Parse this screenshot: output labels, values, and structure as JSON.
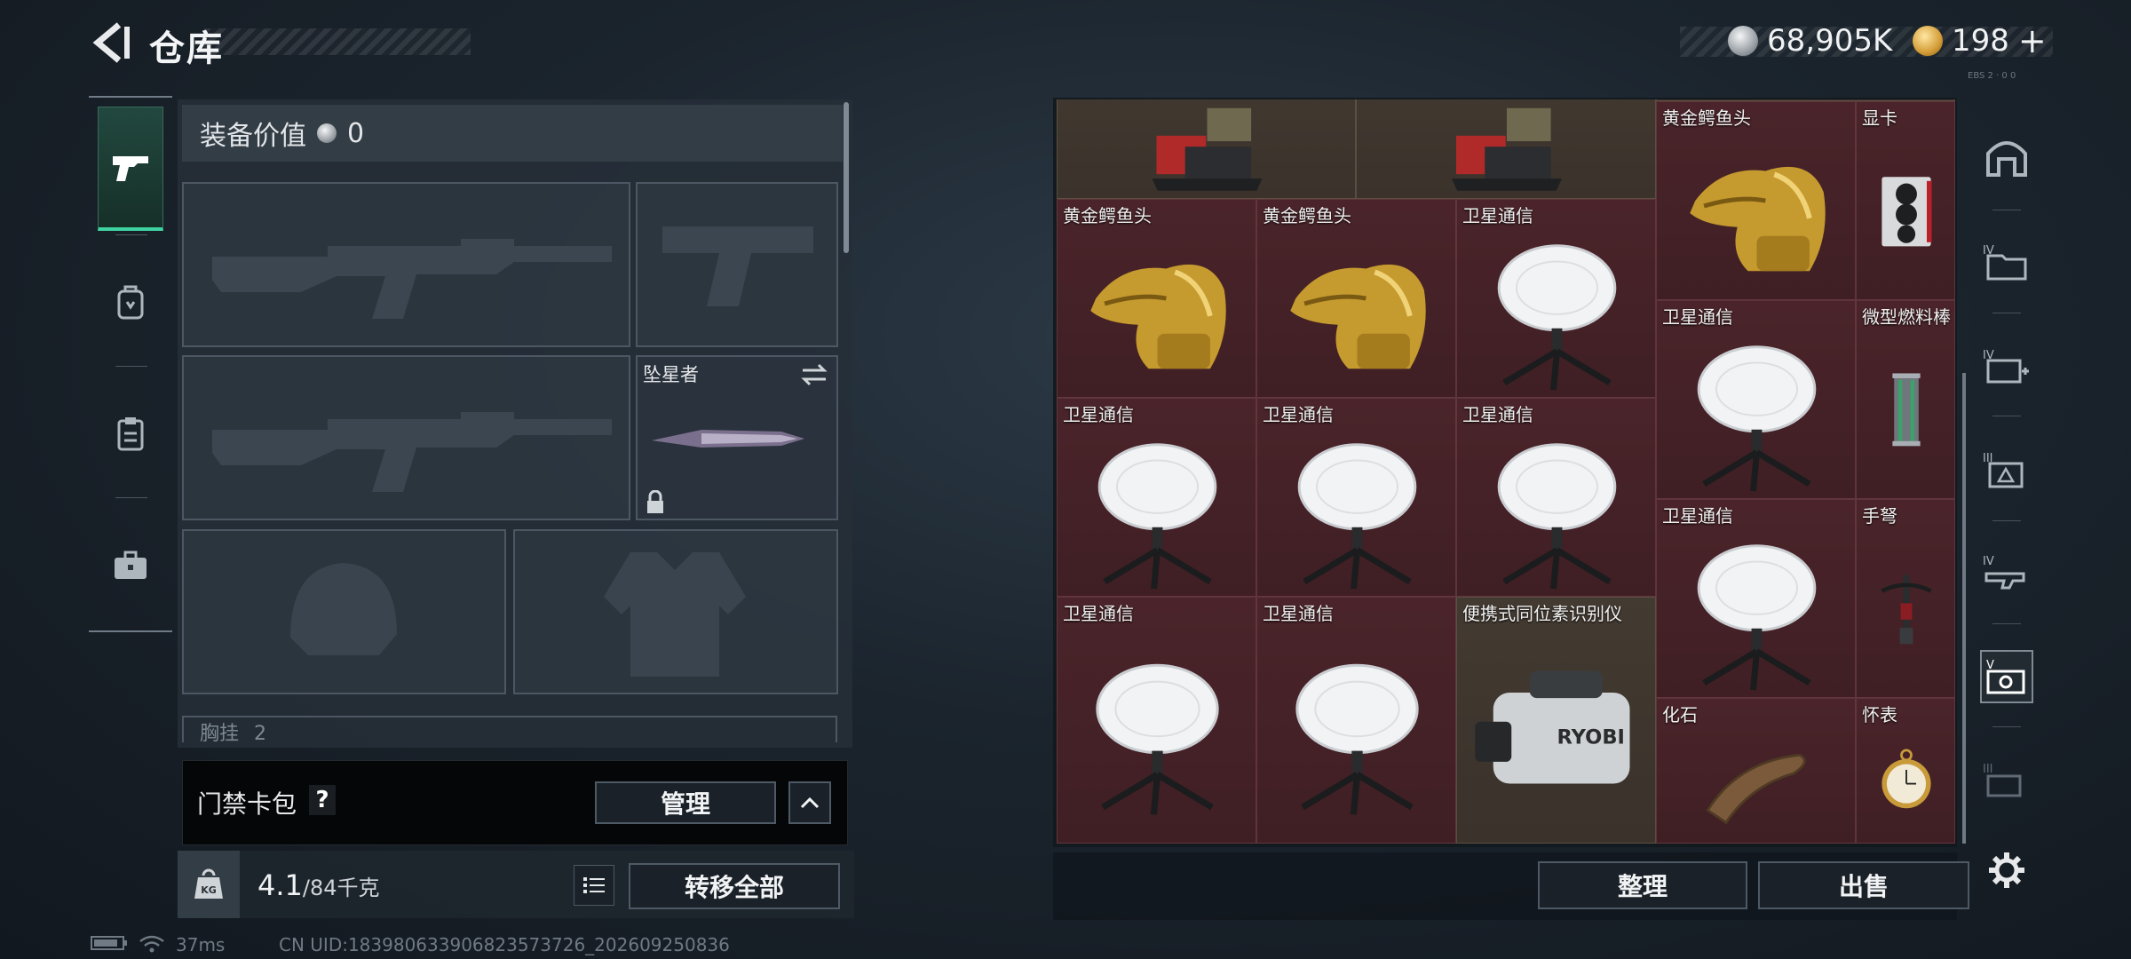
{
  "header": {
    "title": "仓库",
    "currency_silver": "68,905K",
    "currency_gold": "198",
    "gold_plus": "+",
    "corner_code": "EBS 2 · 0 0"
  },
  "loadout": {
    "equip_value_label": "装备价值",
    "equip_value": "0",
    "melee_name": "坠星者",
    "chest_rig_label": "胸挂",
    "chest_rig_value": "2"
  },
  "card_bag": {
    "label": "门禁卡包",
    "help": "?",
    "manage_button": "管理"
  },
  "weight": {
    "kg_label": "KG",
    "current": "4.1",
    "max": "/84千克",
    "transfer_all_button": "转移全部"
  },
  "status": {
    "ping": "37ms",
    "uid": "CN UID:183980633906823573726_202609250836"
  },
  "inventory": {
    "items": [
      {
        "name": "",
        "art": "crate"
      },
      {
        "name": "",
        "art": "crate"
      },
      {
        "name": "",
        "art": "ornament"
      },
      {
        "name": "黄金鳄鱼头",
        "art": "gold-croc"
      },
      {
        "name": "显卡",
        "art": "gpu"
      },
      {
        "name": "黄金鳄鱼头",
        "art": "gold-croc"
      },
      {
        "name": "黄金鳄鱼头",
        "art": "gold-croc"
      },
      {
        "name": "卫星通信",
        "art": "dish"
      },
      {
        "name": "卫星通信",
        "art": "dish"
      },
      {
        "name": "微型燃料棒",
        "art": "fuel-rod"
      },
      {
        "name": "卫星通信",
        "art": "dish"
      },
      {
        "name": "卫星通信",
        "art": "dish"
      },
      {
        "name": "卫星通信",
        "art": "dish"
      },
      {
        "name": "卫星通信",
        "art": "dish"
      },
      {
        "name": "手弩",
        "art": "crossbow"
      },
      {
        "name": "卫星通信",
        "art": "dish"
      },
      {
        "name": "卫星通信",
        "art": "dish"
      },
      {
        "name": "便携式同位素识别仪",
        "art": "detector"
      },
      {
        "name": "化石",
        "art": "fossil"
      },
      {
        "name": "怀表",
        "art": "pocket-watch"
      }
    ],
    "detector_brand": "RYOBI",
    "sort_button": "整理",
    "sell_button": "出售"
  },
  "side_tabs": [
    "IV",
    "IV",
    "III",
    "IV",
    "V",
    "III"
  ],
  "colors": {
    "accent_green": "#3fd3a2",
    "cell_red": "#4a242a",
    "cell_tan": "#433a31"
  }
}
